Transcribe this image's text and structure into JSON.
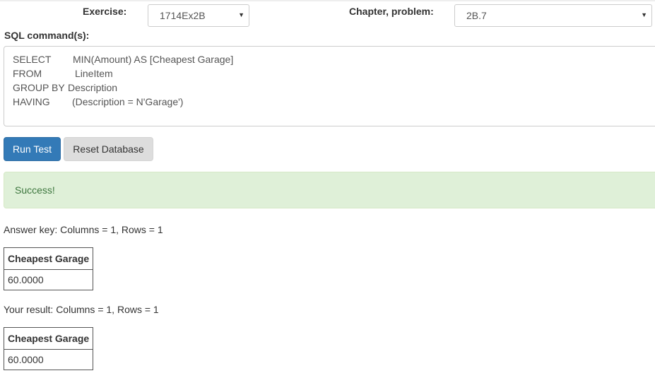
{
  "exercise": {
    "label": "Exercise:",
    "selected": "1714Ex2B"
  },
  "chapter": {
    "label": "Chapter, problem:",
    "selected": "2B.7"
  },
  "sql": {
    "label": "SQL command(s):",
    "lines": [
      {
        "keyword": "SELECT",
        "text": "MIN(Amount) AS [Cheapest Garage]"
      },
      {
        "keyword": "FROM",
        "text": "LineItem"
      },
      {
        "keyword": "GROUP BY",
        "text": "Description"
      },
      {
        "keyword": "HAVING",
        "text": "(Description = N'Garage')"
      }
    ]
  },
  "buttons": {
    "run": "Run Test",
    "reset": "Reset Database"
  },
  "alert": {
    "message": "Success!",
    "color": "#3c763d",
    "background": "#dff0d8"
  },
  "answer_key": {
    "summary": "Answer key: Columns = 1, Rows = 1",
    "header": "Cheapest Garage",
    "value": "60.0000"
  },
  "your_result": {
    "summary": "Your result: Columns = 1, Rows = 1",
    "header": "Cheapest Garage",
    "value": "60.0000"
  },
  "colors": {
    "primary": "#337ab7",
    "default_button": "#dddddd"
  },
  "icons": {
    "select_caret": "caret-down-icon"
  }
}
